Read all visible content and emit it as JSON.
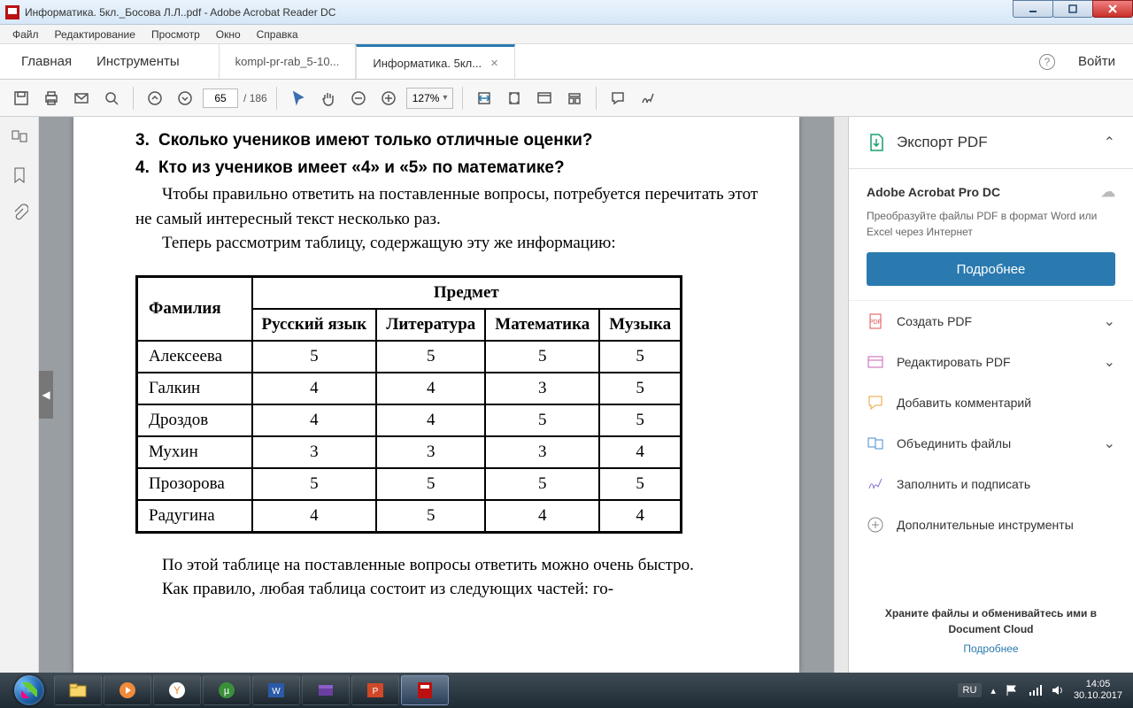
{
  "window": {
    "title": "Информатика. 5кл._Босова Л.Л..pdf - Adobe Acrobat Reader DC"
  },
  "menu": {
    "file": "Файл",
    "edit": "Редактирование",
    "view": "Просмотр",
    "window": "Окно",
    "help": "Справка"
  },
  "tabs": {
    "home": "Главная",
    "tools": "Инструменты",
    "doc1": "kompl-pr-rab_5-10...",
    "doc2": "Информатика. 5кл...",
    "login": "Войти"
  },
  "toolbar": {
    "page_current": "65",
    "page_sep": "/",
    "page_total": "186",
    "zoom": "127%"
  },
  "doc": {
    "q3_n": "3.",
    "q3": "Сколько учеников имеют только отличные оценки?",
    "q4_n": "4.",
    "q4": "Кто из учеников имеет «4» и «5» по математике?",
    "p1": "Чтобы правильно ответить на поставленные вопросы, потребуется перечитать этот не самый интересный текст несколько раз.",
    "p2": "Теперь рассмотрим таблицу, содержащую эту же информацию:",
    "p3": "По этой таблице на поставленные вопросы ответить можно очень быстро.",
    "p4": "Как правило, любая таблица состоит из следующих частей: го-",
    "table": {
      "head_fam": "Фамилия",
      "head_subj": "Предмет",
      "subjects": [
        "Русский язык",
        "Литература",
        "Математика",
        "Музыка"
      ],
      "rows": [
        {
          "name": "Алексеева",
          "g": [
            "5",
            "5",
            "5",
            "5"
          ]
        },
        {
          "name": "Галкин",
          "g": [
            "4",
            "4",
            "3",
            "5"
          ]
        },
        {
          "name": "Дроздов",
          "g": [
            "4",
            "4",
            "5",
            "5"
          ]
        },
        {
          "name": "Мухин",
          "g": [
            "3",
            "3",
            "3",
            "4"
          ]
        },
        {
          "name": "Прозорова",
          "g": [
            "5",
            "5",
            "5",
            "5"
          ]
        },
        {
          "name": "Радугина",
          "g": [
            "4",
            "5",
            "4",
            "4"
          ]
        }
      ]
    }
  },
  "right": {
    "export": "Экспорт PDF",
    "product": "Adobe Acrobat Pro DC",
    "desc": "Преобразуйте файлы PDF в формат Word или Excel через Интернет",
    "cta": "Подробнее",
    "items": {
      "create": "Создать PDF",
      "edit": "Редактировать PDF",
      "comment": "Добавить комментарий",
      "combine": "Объединить файлы",
      "fillsign": "Заполнить и подписать",
      "more": "Дополнительные инструменты"
    },
    "foot1": "Храните файлы и обменивайтесь ими в Document Cloud",
    "foot2": "Подробнее"
  },
  "tray": {
    "lang": "RU",
    "time": "14:05",
    "date": "30.10.2017"
  }
}
